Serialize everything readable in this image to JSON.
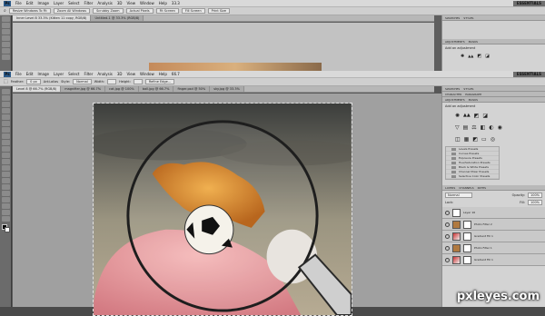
{
  "back_window": {
    "menu": [
      "File",
      "Edit",
      "Image",
      "Layer",
      "Select",
      "Filter",
      "Analysis",
      "3D",
      "View",
      "Window",
      "Help"
    ],
    "zoom": "33.3",
    "essentials": "ESSENTIALS",
    "options": [
      "Resize Windows To Fit",
      "Zoom All Windows",
      "Scrubby Zoom",
      "Actual Pixels",
      "Fit Screen",
      "Fill Screen",
      "Print Size"
    ],
    "tabs": [
      "Inner Level 8 33.3% (Kitten 11 copy, RGB/8)",
      "Untitled-1 @ 33.3% (RGB/8)"
    ],
    "panels": {
      "top_tabs": [
        "SWATCHES",
        "STYLES"
      ],
      "adjust_tabs": [
        "ADJUSTMENTS",
        "MASKS"
      ],
      "adjust_title": "Add an adjustment"
    }
  },
  "front_window": {
    "menu": [
      "File",
      "Edit",
      "Image",
      "Layer",
      "Select",
      "Filter",
      "Analysis",
      "3D",
      "View",
      "Window",
      "Help"
    ],
    "zoom": "66.7",
    "essentials": "ESSENTIALS",
    "options": [
      "Feather:",
      "0 px",
      "Anti-alias",
      "Style:",
      "Normal",
      "Width:",
      "Height:",
      "Refine Edge..."
    ],
    "tabs": [
      "Level 8 @ 66.7% (RGB/8)",
      "magnifier.jpg @ 66.7%",
      "cat.jpg @ 100%",
      "ball.jpg @ 66.7%",
      "finger.psd @ 50%",
      "sky.jpg @ 33.3%"
    ],
    "panels": {
      "top_tabs": [
        "SWATCHES",
        "STYLES",
        "CHARACTER",
        "PARAGRAPH"
      ],
      "adjust_tabs": [
        "ADJUSTMENTS",
        "MASKS"
      ],
      "adjust_title": "Add an adjustment",
      "presets": [
        "Levels Presets",
        "Curves Presets",
        "Exposure Presets",
        "Hue/Saturation Presets",
        "Black & White Presets",
        "Channel Mixer Presets",
        "Selective Color Presets"
      ],
      "layer_tabs": [
        "LAYERS",
        "CHANNELS",
        "PATHS"
      ],
      "blend_mode": "Normal",
      "opacity_label": "Opacity:",
      "opacity": "100%",
      "lock_label": "Lock:",
      "fill_label": "Fill:",
      "fill": "100%",
      "layers": [
        "Layer 16",
        "Photo Filter 2",
        "Gradient Fill 1",
        "Photo Filter 1",
        "Gradient Fill 1"
      ]
    }
  },
  "watermark": "pxleyes.com",
  "colors": {
    "accent": "#2b5a8a"
  }
}
